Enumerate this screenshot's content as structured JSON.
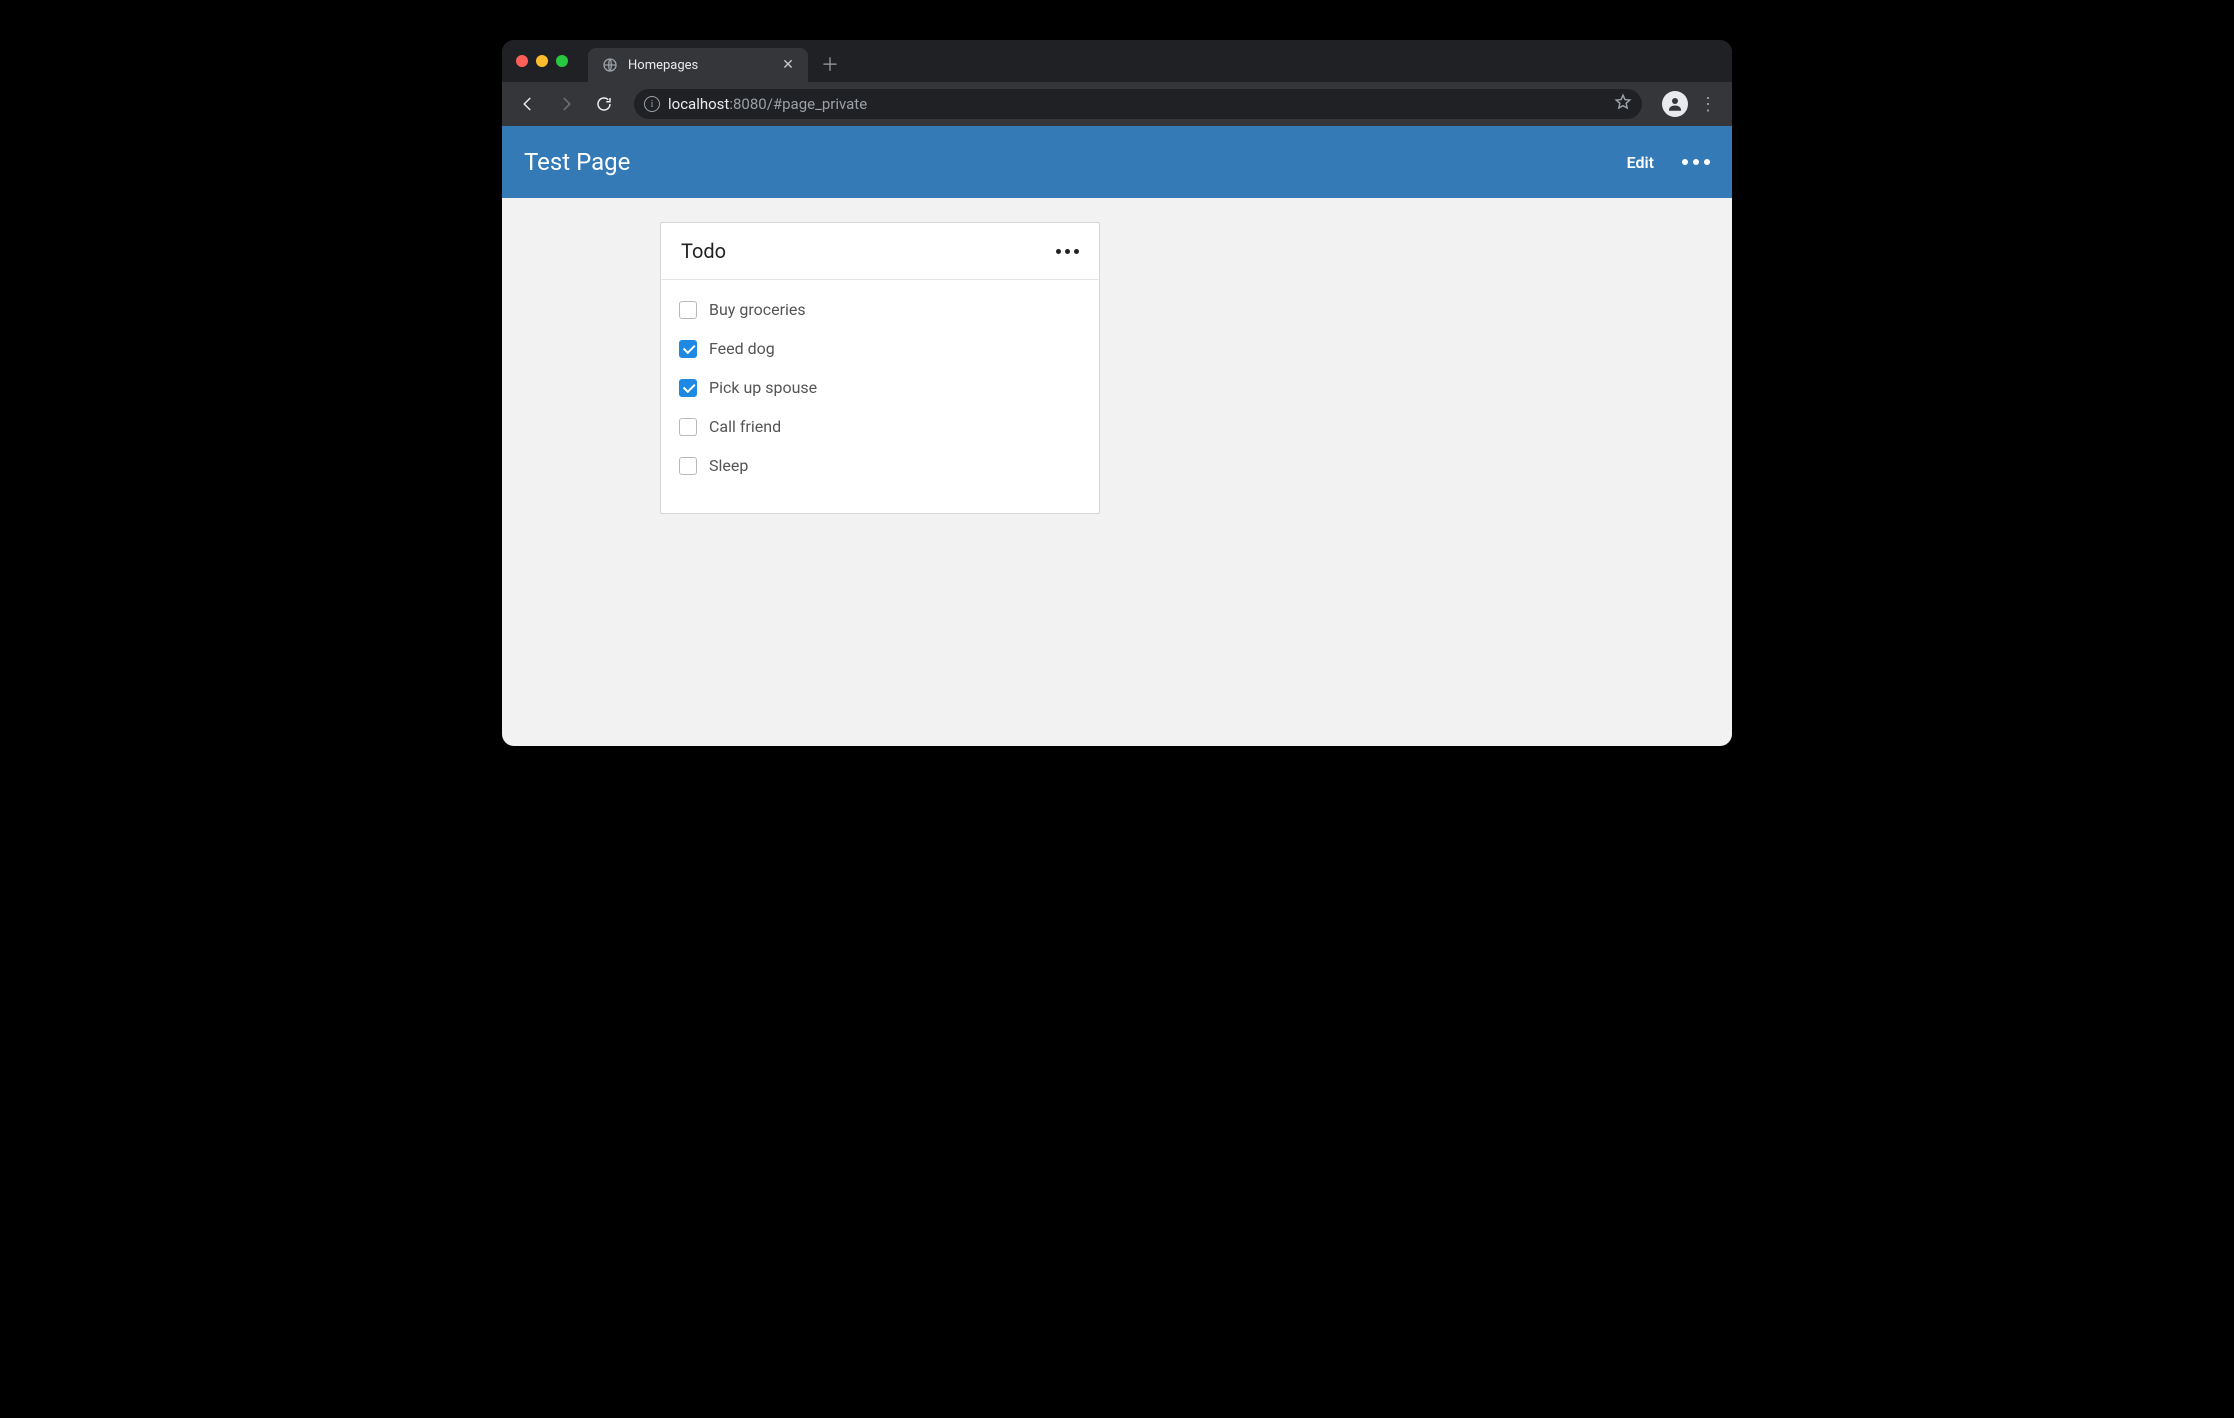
{
  "browser": {
    "tab_title": "Homepages",
    "url_host": "localhost",
    "url_port": ":8080",
    "url_path": "/#page_private"
  },
  "appbar": {
    "title": "Test Page",
    "edit_label": "Edit"
  },
  "card": {
    "title": "Todo"
  },
  "todos": [
    {
      "label": "Buy groceries",
      "checked": false
    },
    {
      "label": "Feed dog",
      "checked": true
    },
    {
      "label": "Pick up spouse",
      "checked": true
    },
    {
      "label": "Call friend",
      "checked": false
    },
    {
      "label": "Sleep",
      "checked": false
    }
  ]
}
